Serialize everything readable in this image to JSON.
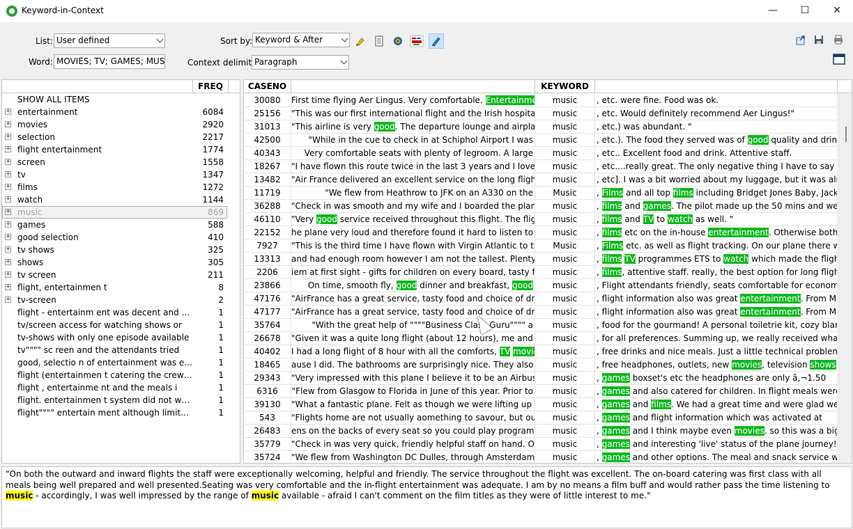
{
  "window": {
    "title": "Keyword-in-Context"
  },
  "toolbar": {
    "list_label": "List:",
    "list_value": "User defined",
    "word_label": "Word:",
    "word_value": "MOVIES; TV; GAMES; MUSIC; SH",
    "sort_label": "Sort by:",
    "sort_value": "Keyword & After",
    "delim_label": "Context delimiter:",
    "delim_value": "Paragraph",
    "icons": [
      "highlighter-icon",
      "rtf-export-icon",
      "target-icon",
      "word-cloud-icon",
      "pen-icon",
      "export-icon",
      "save-icon",
      "print-icon",
      "window-icon"
    ]
  },
  "left_panel": {
    "freq_header": "FREQ",
    "show_all": "SHOW ALL ITEMS",
    "items": [
      {
        "label": "entertainment",
        "freq": "6084",
        "expandable": true
      },
      {
        "label": "movies",
        "freq": "2920",
        "expandable": true
      },
      {
        "label": "selection",
        "freq": "2217",
        "expandable": true
      },
      {
        "label": "flight entertainment",
        "freq": "1774",
        "expandable": true
      },
      {
        "label": "screen",
        "freq": "1558",
        "expandable": true
      },
      {
        "label": "tv",
        "freq": "1347",
        "expandable": true
      },
      {
        "label": "films",
        "freq": "1272",
        "expandable": true
      },
      {
        "label": "watch",
        "freq": "1144",
        "expandable": true
      },
      {
        "label": "music",
        "freq": "869",
        "expandable": true,
        "dim": true
      },
      {
        "label": "games",
        "freq": "588",
        "expandable": true
      },
      {
        "label": "good selection",
        "freq": "410",
        "expandable": true
      },
      {
        "label": "tv shows",
        "freq": "325",
        "expandable": true
      },
      {
        "label": "shows",
        "freq": "305",
        "expandable": true
      },
      {
        "label": "tv screen",
        "freq": "211",
        "expandable": true
      },
      {
        "label": "flight, entertainmen t",
        "freq": "8",
        "expandable": true
      },
      {
        "label": "tv-screen",
        "freq": "2",
        "expandable": true
      },
      {
        "label": "flight  - entertainm ent was decent and ma...",
        "freq": "1",
        "expandable": false
      },
      {
        "label": "tv/screen access for watching shows or",
        "freq": "1",
        "expandable": false
      },
      {
        "label": "tv-shows with only one episode available",
        "freq": "1",
        "expandable": false
      },
      {
        "label": "tv\"\"\"\" sc reen and the attendants tried",
        "freq": "1",
        "expandable": false
      },
      {
        "label": "good, selectio n of entertainment was exc...",
        "freq": "1",
        "expandable": false
      },
      {
        "label": "flight (entertainmen t catering the crew w...",
        "freq": "1",
        "expandable": false
      },
      {
        "label": "flight , entertainme nt and the meals i",
        "freq": "1",
        "expandable": false
      },
      {
        "label": "flight. entertainmen t system did not work",
        "freq": "1",
        "expandable": false
      },
      {
        "label": "flight\"\"\"\" entertain ment although limited to a",
        "freq": "1",
        "expandable": false
      }
    ]
  },
  "grid": {
    "headers": {
      "case": "CASENO",
      "before": "",
      "keyword": "KEYWORD",
      "after": ""
    },
    "rows": [
      {
        "case": "30080",
        "before": [
          [
            "First time flying Aer Lingus. Very comfortable. ",
            0
          ],
          [
            "Entertainment",
            1
          ]
        ],
        "kw": "music",
        "after": [
          [
            ", etc. were fine. Food was ok.",
            0
          ]
        ]
      },
      {
        "case": "25156",
        "before": [
          [
            "\"This was our first international flight and the Irish hospitality",
            0
          ]
        ],
        "kw": "music",
        "after": [
          [
            ", etc. Would definitely recommend Aer Lingus!\"",
            0
          ]
        ]
      },
      {
        "case": "31013",
        "before": [
          [
            "\"This airline is very ",
            0
          ],
          [
            "good",
            1
          ],
          [
            ". The departure lounge and airplane",
            0
          ]
        ],
        "kw": "music",
        "after": [
          [
            ", etc.) was abundant. \"",
            0
          ]
        ]
      },
      {
        "case": "42500",
        "before": [
          [
            "\"While in the cue to check in at Schiphol Airport I was",
            0
          ]
        ],
        "kw": "music",
        "after": [
          [
            ", etc.). The food they served was of ",
            0
          ],
          [
            "good",
            1
          ],
          [
            " quality and drinks",
            0
          ]
        ]
      },
      {
        "case": "40343",
        "before": [
          [
            "Very comfortable seats with plenty of legroom. A large",
            0
          ]
        ],
        "kw": "music",
        "after": [
          [
            ", etc.. Excellent food and drink. Attentive staff.",
            0
          ]
        ]
      },
      {
        "case": "18267",
        "before": [
          [
            "\"I have flown this route twice in the last 3 years and I loved",
            0
          ]
        ],
        "kw": "music",
        "after": [
          [
            ", etc....really great. The only negative thing I have to say about",
            0
          ]
        ]
      },
      {
        "case": "13482",
        "before": [
          [
            "\"Air France delivered an excellent service on the long flight to",
            0
          ]
        ],
        "kw": "music",
        "after": [
          [
            ", etc]. I was a bit worried about my luggage, but it was alright",
            0
          ]
        ]
      },
      {
        "case": "11719",
        "before": [
          [
            "\"We flew from Heathrow to JFK on an A330 on the",
            0
          ]
        ],
        "kw": "Music",
        "after": [
          [
            ", ",
            0
          ],
          [
            "Films",
            1
          ],
          [
            " and all top ",
            0
          ],
          [
            "films",
            1
          ],
          [
            " including Bridget Jones Baby, Jack",
            0
          ]
        ]
      },
      {
        "case": "36288",
        "before": [
          [
            "\"Check in was smooth and my wife and I boarded the plane",
            0
          ]
        ],
        "kw": "music",
        "after": [
          [
            ", ",
            0
          ],
          [
            "films",
            1
          ],
          [
            " and ",
            0
          ],
          [
            "games",
            1
          ],
          [
            ". The pilot made up the 50 mins and we",
            0
          ]
        ]
      },
      {
        "case": "46110",
        "before": [
          [
            "\"Very ",
            0
          ],
          [
            "good",
            1
          ],
          [
            " service received throughout this flight. The flight",
            0
          ]
        ],
        "kw": "music",
        "after": [
          [
            ", ",
            0
          ],
          [
            "films",
            1
          ],
          [
            " and ",
            0
          ],
          [
            "TV",
            1
          ],
          [
            " to ",
            0
          ],
          [
            "watch",
            1
          ],
          [
            " as well. \"",
            0
          ]
        ]
      },
      {
        "case": "22152",
        "before": [
          [
            "he plane very loud and therefore found it hard to listen to the",
            0
          ]
        ],
        "kw": "music",
        "after": [
          [
            ", ",
            0
          ],
          [
            "films",
            1
          ],
          [
            " etc on the in-house ",
            0
          ],
          [
            "entertainment",
            1
          ],
          [
            ". Otherwise both",
            0
          ]
        ]
      },
      {
        "case": "7927",
        "before": [
          [
            "\"This is the third time I have flown with Virgin Atlantic to the",
            0
          ]
        ],
        "kw": "Music",
        "after": [
          [
            ", ",
            0
          ],
          [
            "Films",
            1
          ],
          [
            " etc. as well as flight tracking. On our plane there was",
            0
          ]
        ]
      },
      {
        "case": "13313",
        "before": [
          [
            "and had enough room however I am not the tallest. Plenty of",
            0
          ]
        ],
        "kw": "music",
        "after": [
          [
            ", ",
            0
          ],
          [
            "films",
            1
          ],
          [
            " ",
            0
          ],
          [
            "TV",
            1
          ],
          [
            " programmes ETS to ",
            0
          ],
          [
            "watch",
            1
          ],
          [
            " which made the flight",
            0
          ]
        ]
      },
      {
        "case": "2206",
        "before": [
          [
            "iem at first sight - gifts for children on every board, tasty food,",
            0
          ]
        ],
        "kw": "music",
        "after": [
          [
            ", ",
            0
          ],
          [
            "films",
            1
          ],
          [
            ", attentive staff. really, the best option for long flights -",
            0
          ]
        ]
      },
      {
        "case": "23866",
        "before": [
          [
            "On time, smooth fly, ",
            0
          ],
          [
            "good",
            1
          ],
          [
            " dinner and breakfast, ",
            0
          ],
          [
            "good",
            1
          ]
        ],
        "kw": "music",
        "after": [
          [
            ", Flight attendants friendly, seats comfortable for economy ser",
            0
          ]
        ]
      },
      {
        "case": "47176",
        "before": [
          [
            "\"AirFrance has a great service, tasty food and choice of drinks",
            0
          ]
        ],
        "kw": "music",
        "after": [
          [
            ", flight information also was great ",
            0
          ],
          [
            "entertainment",
            1
          ],
          [
            ". From Miami",
            0
          ]
        ]
      },
      {
        "case": "47177",
        "before": [
          [
            "\"AirFrance has a great service, tasty food and choice of drinks",
            0
          ]
        ],
        "kw": "music",
        "after": [
          [
            ", flight information also was great ",
            0
          ],
          [
            "entertainment",
            1
          ],
          [
            ". From Miami",
            0
          ]
        ]
      },
      {
        "case": "35764",
        "before": [
          [
            "\"With the great help of \"\"\"\"Business Class Guru\"\"\"\" a",
            0
          ]
        ],
        "kw": "music",
        "after": [
          [
            ", food for the gourmand! A personal toiletrie kit, cozy blanket,",
            0
          ]
        ]
      },
      {
        "case": "26678",
        "before": [
          [
            "\"Given it was a quite long flight (about 12 hours), me and my",
            0
          ]
        ],
        "kw": "music",
        "after": [
          [
            ", for all preferences. Summing up, we really received what we",
            0
          ]
        ]
      },
      {
        "case": "40402",
        "before": [
          [
            "I had a long flight of 8 hour with all the comforts, ",
            0
          ],
          [
            "TV",
            1
          ],
          [
            " ",
            0
          ],
          [
            "movie",
            1
          ]
        ],
        "kw": "music",
        "after": [
          [
            ", free drinks and nice meals. Just a little technical problem at th",
            0
          ]
        ]
      },
      {
        "case": "18465",
        "before": [
          [
            "ause I did. The bathrooms are surprisingly nice. They also have",
            0
          ]
        ],
        "kw": "music",
        "after": [
          [
            ", free headphones, outlets, new ",
            0
          ],
          [
            "movies",
            1
          ],
          [
            ", television ",
            0
          ],
          [
            "shows",
            1
          ],
          [
            ".",
            0
          ]
        ]
      },
      {
        "case": "29343",
        "before": [
          [
            "\"Very impressed with this plane I believe it to be an Airbus",
            0
          ]
        ],
        "kw": "music",
        "after": [
          [
            ", ",
            0
          ],
          [
            "games",
            1
          ],
          [
            " boxset's etc the headphones are only â‚¬1.50",
            0
          ]
        ]
      },
      {
        "case": "6316",
        "before": [
          [
            "\"Flew from Glasgow to Florida in June of this year.  Prior to",
            0
          ]
        ],
        "kw": "music",
        "after": [
          [
            ", ",
            0
          ],
          [
            "games",
            1
          ],
          [
            " and also catered for children.  In flight meals were of",
            0
          ]
        ]
      },
      {
        "case": "39130",
        "before": [
          [
            "\"What a fantastic plane. Felt as though we were lifting up on",
            0
          ]
        ],
        "kw": "music",
        "after": [
          [
            ", ",
            0
          ],
          [
            "games",
            1
          ],
          [
            " and ",
            0
          ],
          [
            "films",
            1
          ],
          [
            ". We had a great time and were glad we'd",
            0
          ]
        ]
      },
      {
        "case": "543",
        "before": [
          [
            "\"Flights home are not usually aomething to savour, but our",
            0
          ]
        ],
        "kw": "music",
        "after": [
          [
            ", ",
            0
          ],
          [
            "games",
            1
          ],
          [
            " and flight information which was activated at",
            0
          ]
        ]
      },
      {
        "case": "26483",
        "before": [
          [
            "ens on the backs of every seat so you could play programmed",
            0
          ]
        ],
        "kw": "music",
        "after": [
          [
            ", ",
            0
          ],
          [
            "games",
            1
          ],
          [
            " and I think maybe even ",
            0
          ],
          [
            "movies",
            1
          ],
          [
            ". so this was a big",
            0
          ]
        ]
      },
      {
        "case": "35779",
        "before": [
          [
            "\"Check in was very quick, friendly helpful staff on hand. Our",
            0
          ]
        ],
        "kw": "music",
        "after": [
          [
            ", ",
            0
          ],
          [
            "games",
            1
          ],
          [
            " and interesting 'live' status of the plane journey!",
            0
          ]
        ]
      },
      {
        "case": "35724",
        "before": [
          [
            "\"We flew from Washington DC Dulles, through Amsterdam to",
            0
          ]
        ],
        "kw": "music",
        "after": [
          [
            ", ",
            0
          ],
          [
            "games",
            1
          ],
          [
            " and other options. The meal and snack service was",
            0
          ]
        ]
      }
    ]
  },
  "bottom_text": [
    [
      "\"On both the outward and inward flights the staff were exceptionally welcoming, helpful and friendly. The service throughout the flight was excellent. The on-board catering was first class with all meals being well prepared and well presented.Seating was very comfortable and the in-flight entertainment was adequate. I am by no means a film buff and would rather pass the time listening to ",
      0
    ],
    [
      "music",
      1
    ],
    [
      " - accordingly, I was well impressed by the range of ",
      0
    ],
    [
      "music",
      1
    ],
    [
      " available - afraid I can't comment on the film titles as they were of little interest to me.\"",
      0
    ]
  ]
}
